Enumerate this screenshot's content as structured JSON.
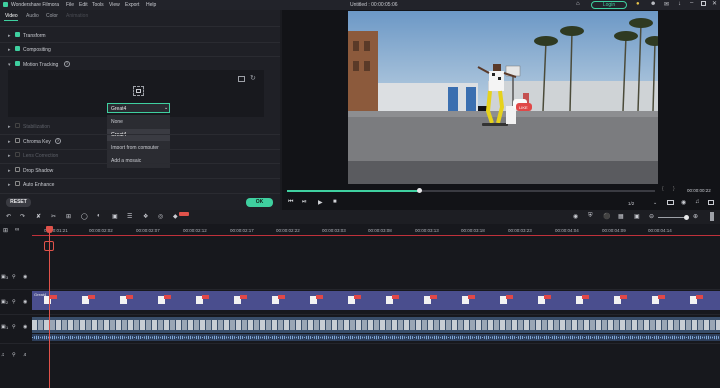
{
  "app": {
    "name": "Wondershare Filmora",
    "menu": [
      "File",
      "Edit",
      "Tools",
      "View",
      "Export",
      "Help"
    ],
    "project_title": "Untitled : 00:00:05:06",
    "login_label": "Login"
  },
  "panel": {
    "tabs": [
      "Video",
      "Audio",
      "Color",
      "Animation"
    ],
    "sections": {
      "transform": "Transform",
      "compositing": "Compositing",
      "motion_tracking": "Motion Tracking",
      "stabilization": "Stabilization",
      "chroma_key": "Chroma Key",
      "lens_correction": "Lens Correction",
      "drop_shadow": "Drop Shadow",
      "auto_enhance": "Auto Enhance"
    },
    "dropdown": {
      "selected": "Great4",
      "options": [
        "None",
        "Great4",
        "Import from computer",
        "Add a mosaic"
      ]
    },
    "reset_label": "RESET",
    "ok_label": "OK"
  },
  "player": {
    "progress": 0.36,
    "timecode": "00:00:00:22",
    "page_select": "1/2"
  },
  "timeline": {
    "ticks": [
      "00:00:01:21",
      "00:00:02:02",
      "00:00:02:07",
      "00:00:02:12",
      "00:00:02:17",
      "00:00:02:22",
      "00:00:03:03",
      "00:00:03:08",
      "00:00:03:13",
      "00:00:03:18",
      "00:00:03:23",
      "00:00:04:04",
      "00:00:04:09",
      "00:00:04:14"
    ],
    "element_clip_label": "Great4",
    "tracks": {
      "t3": "3",
      "t2": "2",
      "t1": "1"
    }
  },
  "colors": {
    "accent": "#3fd0a0",
    "playhead": "#e0524a",
    "element_track": "#4a4e8e",
    "video_track": "#394e6a"
  }
}
